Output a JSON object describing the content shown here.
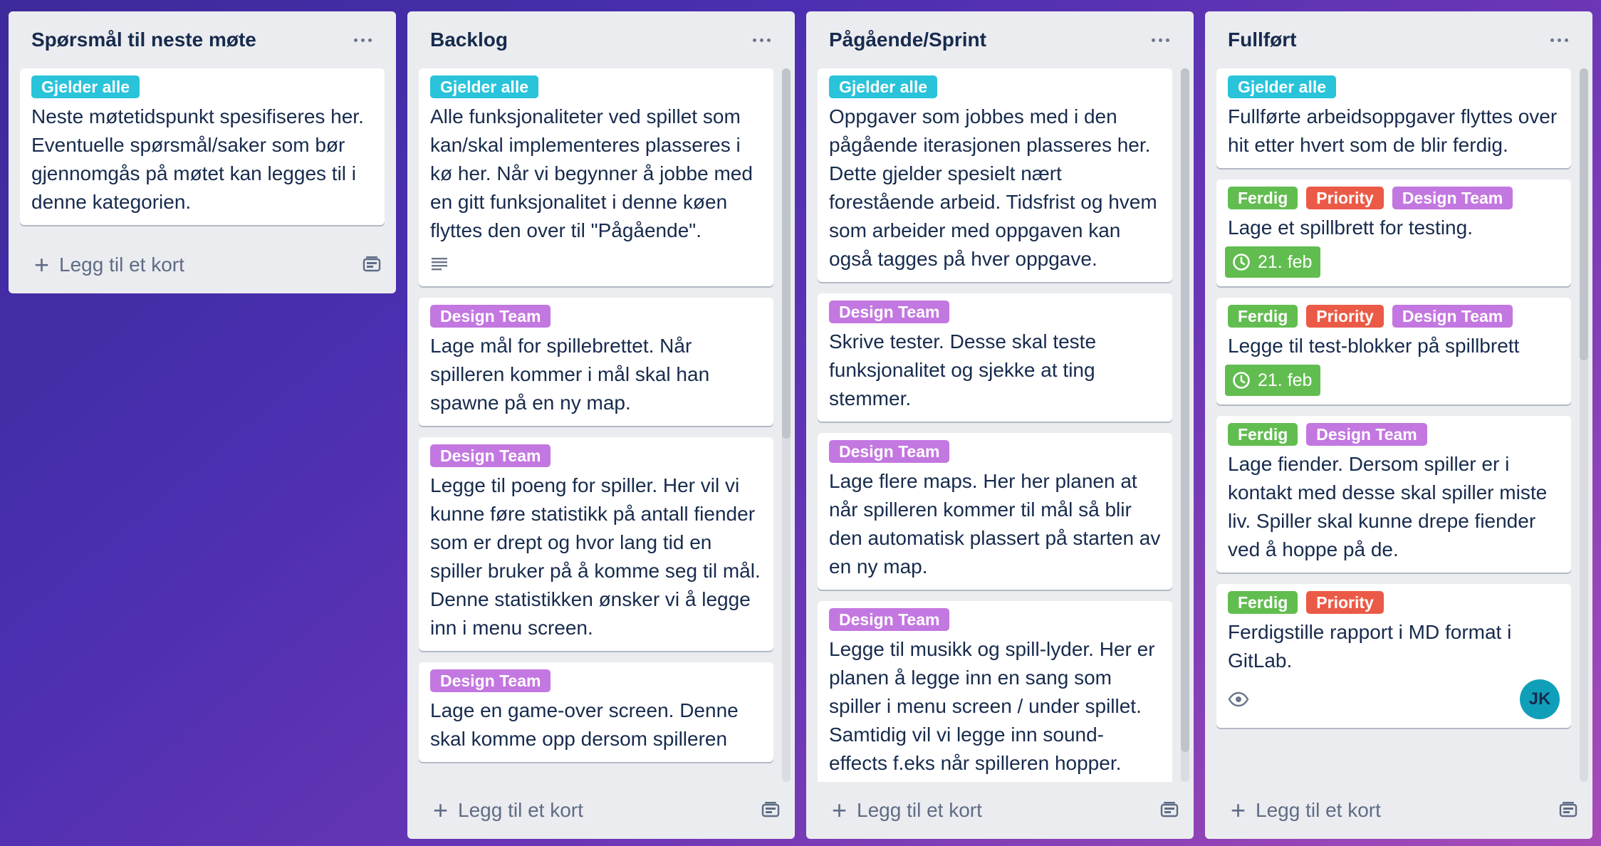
{
  "colors": {
    "label_gjelder": "#29c3da",
    "label_design": "#c377e0",
    "label_ferdig": "#61bd4f",
    "label_priority": "#eb5a46"
  },
  "footer_label": "Legg til et kort",
  "lists": [
    {
      "title": "Spørsmål til neste møte",
      "cards": [
        {
          "labels": [
            {
              "text": "Gjelder alle",
              "color": "#29c3da"
            }
          ],
          "text": "Neste møtetidspunkt spesifiseres her. Eventuelle spørsmål/saker som bør gjennomgås på møtet kan legges til i denne kategorien."
        }
      ]
    },
    {
      "title": "Backlog",
      "cards": [
        {
          "labels": [
            {
              "text": "Gjelder alle",
              "color": "#29c3da"
            }
          ],
          "text": "Alle funksjonaliteter ved spillet som kan/skal implementeres plasseres i kø her. Når vi begynner å jobbe med en gitt funksjonalitet i denne køen flyttes den over til \"Pågående\".",
          "has_description": true
        },
        {
          "labels": [
            {
              "text": "Design Team",
              "color": "#c377e0"
            }
          ],
          "text": "Lage mål for spillebrettet. Når spilleren kommer i mål skal han spawne på en ny map."
        },
        {
          "labels": [
            {
              "text": "Design Team",
              "color": "#c377e0"
            }
          ],
          "text": "Legge til poeng for spiller. Her vil vi kunne føre statistikk på antall fiender som er drept og hvor lang tid en spiller bruker på å komme seg til mål. Denne statistikken ønsker vi å legge inn i menu screen."
        },
        {
          "labels": [
            {
              "text": "Design Team",
              "color": "#c377e0"
            }
          ],
          "text": "Lage en game-over screen. Denne skal komme opp dersom spilleren"
        }
      ]
    },
    {
      "title": "Pågående/Sprint",
      "cards": [
        {
          "labels": [
            {
              "text": "Gjelder alle",
              "color": "#29c3da"
            }
          ],
          "text": "Oppgaver som jobbes med i den pågående iterasjonen plasseres her. Dette gjelder spesielt nært forestående arbeid. Tidsfrist og hvem som arbeider med oppgaven kan også tagges på hver oppgave."
        },
        {
          "labels": [
            {
              "text": "Design Team",
              "color": "#c377e0"
            }
          ],
          "text": "Skrive tester. Desse skal teste funksjonalitet og sjekke at ting stemmer."
        },
        {
          "labels": [
            {
              "text": "Design Team",
              "color": "#c377e0"
            }
          ],
          "text": "Lage flere maps. Her her planen at når spilleren kommer til mål så blir den automatisk plassert på starten av en ny map."
        },
        {
          "labels": [
            {
              "text": "Design Team",
              "color": "#c377e0"
            }
          ],
          "text": "Legge til musikk og spill-lyder. Her er planen å legge inn en sang som spiller i menu screen / under spillet. Samtidig vil vi legge inn sound-effects f.eks når spilleren hopper."
        }
      ]
    },
    {
      "title": "Fullført",
      "cards": [
        {
          "labels": [
            {
              "text": "Gjelder alle",
              "color": "#29c3da"
            }
          ],
          "text": "Fullførte arbeidsoppgaver flyttes over hit etter hvert som de blir ferdig."
        },
        {
          "labels": [
            {
              "text": "Ferdig",
              "color": "#61bd4f"
            },
            {
              "text": "Priority",
              "color": "#eb5a46"
            },
            {
              "text": "Design Team",
              "color": "#c377e0"
            }
          ],
          "text": "Lage et spillbrett for testing.",
          "due": "21. feb"
        },
        {
          "labels": [
            {
              "text": "Ferdig",
              "color": "#61bd4f"
            },
            {
              "text": "Priority",
              "color": "#eb5a46"
            },
            {
              "text": "Design Team",
              "color": "#c377e0"
            }
          ],
          "text": "Legge til test-blokker på spillbrett",
          "due": "21. feb"
        },
        {
          "labels": [
            {
              "text": "Ferdig",
              "color": "#61bd4f"
            },
            {
              "text": "Design Team",
              "color": "#c377e0"
            }
          ],
          "text": "Lage fiender. Dersom spiller er i kontakt med desse skal spiller miste liv. Spiller skal kunne drepe fiender ved å hoppe på de."
        },
        {
          "labels": [
            {
              "text": "Ferdig",
              "color": "#61bd4f"
            },
            {
              "text": "Priority",
              "color": "#eb5a46"
            }
          ],
          "text": "Ferdigstille rapport i MD format i GitLab.",
          "watching": true,
          "member": "JK"
        }
      ]
    }
  ]
}
